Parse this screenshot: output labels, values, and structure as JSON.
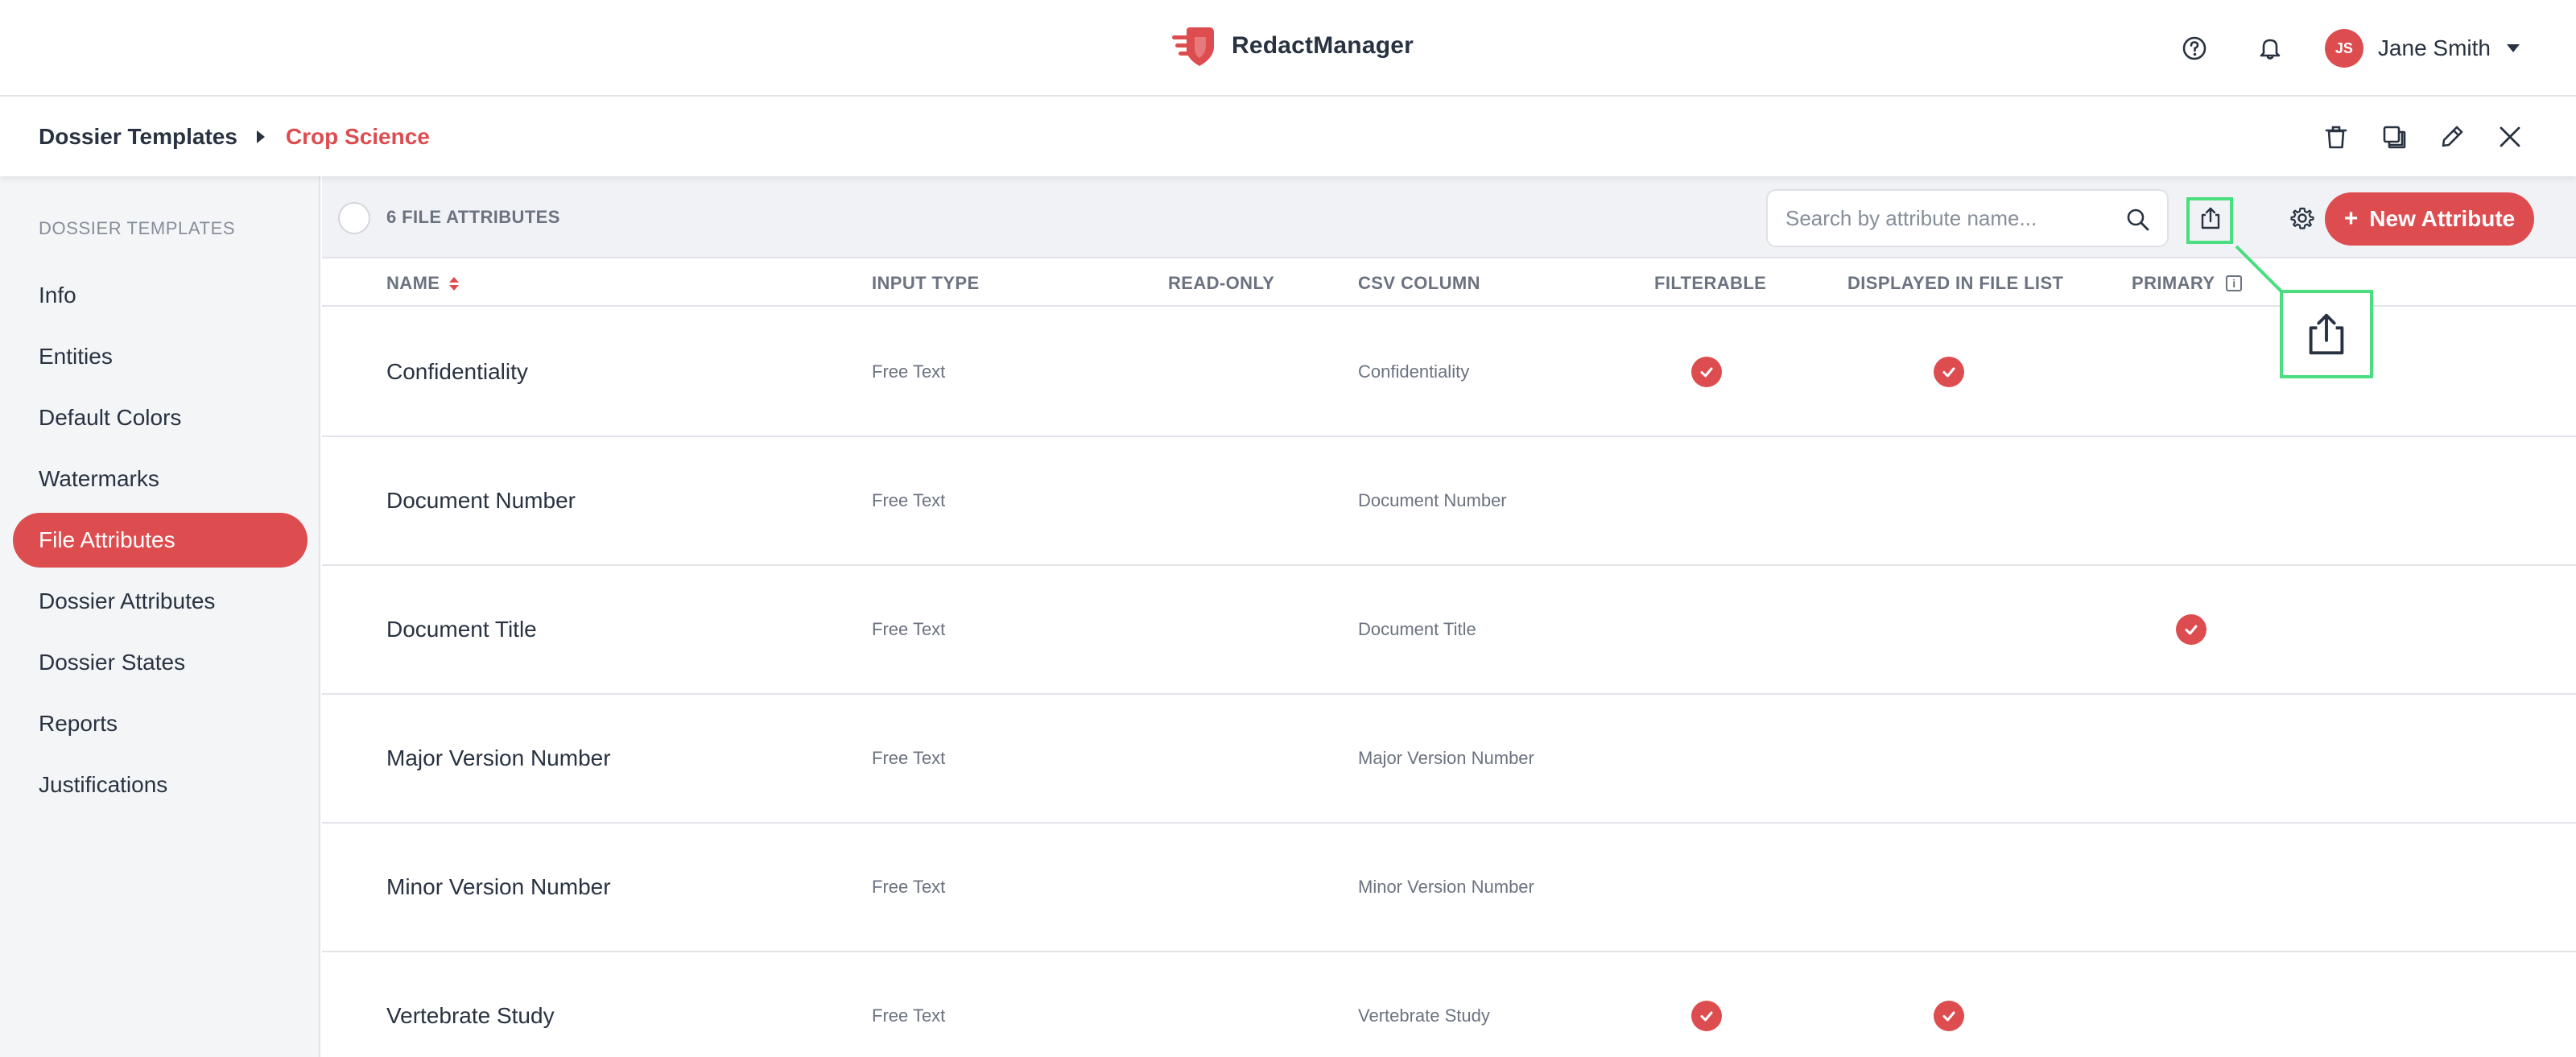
{
  "app": {
    "name": "RedactManager",
    "brand_color": "#dd4d50"
  },
  "user": {
    "initials": "JS",
    "name": "Jane Smith"
  },
  "breadcrumb": {
    "root": "Dossier Templates",
    "current": "Crop Science"
  },
  "sidebar": {
    "title": "DOSSIER TEMPLATES",
    "items": [
      {
        "label": "Info"
      },
      {
        "label": "Entities"
      },
      {
        "label": "Default Colors"
      },
      {
        "label": "Watermarks"
      },
      {
        "label": "File Attributes",
        "active": true
      },
      {
        "label": "Dossier Attributes"
      },
      {
        "label": "Dossier States"
      },
      {
        "label": "Reports"
      },
      {
        "label": "Justifications"
      }
    ]
  },
  "toolbar": {
    "count_label": "6 FILE ATTRIBUTES",
    "search_placeholder": "Search by attribute name...",
    "new_button_label": "New Attribute"
  },
  "table": {
    "columns": {
      "name": "NAME",
      "input_type": "INPUT TYPE",
      "read_only": "READ-ONLY",
      "csv_column": "CSV COLUMN",
      "filterable": "FILTERABLE",
      "displayed": "DISPLAYED IN FILE LIST",
      "primary": "PRIMARY"
    },
    "rows": [
      {
        "name": "Confidentiality",
        "input_type": "Free Text",
        "csv_column": "Confidentiality",
        "filterable": true,
        "displayed": true,
        "primary": false
      },
      {
        "name": "Document Number",
        "input_type": "Free Text",
        "csv_column": "Document Number",
        "filterable": false,
        "displayed": false,
        "primary": false
      },
      {
        "name": "Document Title",
        "input_type": "Free Text",
        "csv_column": "Document Title",
        "filterable": false,
        "displayed": false,
        "primary": true
      },
      {
        "name": "Major Version Number",
        "input_type": "Free Text",
        "csv_column": "Major Version Number",
        "filterable": false,
        "displayed": false,
        "primary": false
      },
      {
        "name": "Minor Version Number",
        "input_type": "Free Text",
        "csv_column": "Minor Version Number",
        "filterable": false,
        "displayed": false,
        "primary": false
      },
      {
        "name": "Vertebrate Study",
        "input_type": "Free Text",
        "csv_column": "Vertebrate Study",
        "filterable": true,
        "displayed": true,
        "primary": false
      }
    ]
  },
  "icons": {
    "help": "help-circle-icon",
    "notifications": "bell-icon",
    "delete": "trash-icon",
    "duplicate": "copy-icon",
    "edit": "pencil-icon",
    "close": "close-icon",
    "search": "search-icon",
    "export": "export-icon",
    "settings": "gear-icon",
    "check": "check-circle-icon"
  },
  "highlight_color": "#4ade80"
}
